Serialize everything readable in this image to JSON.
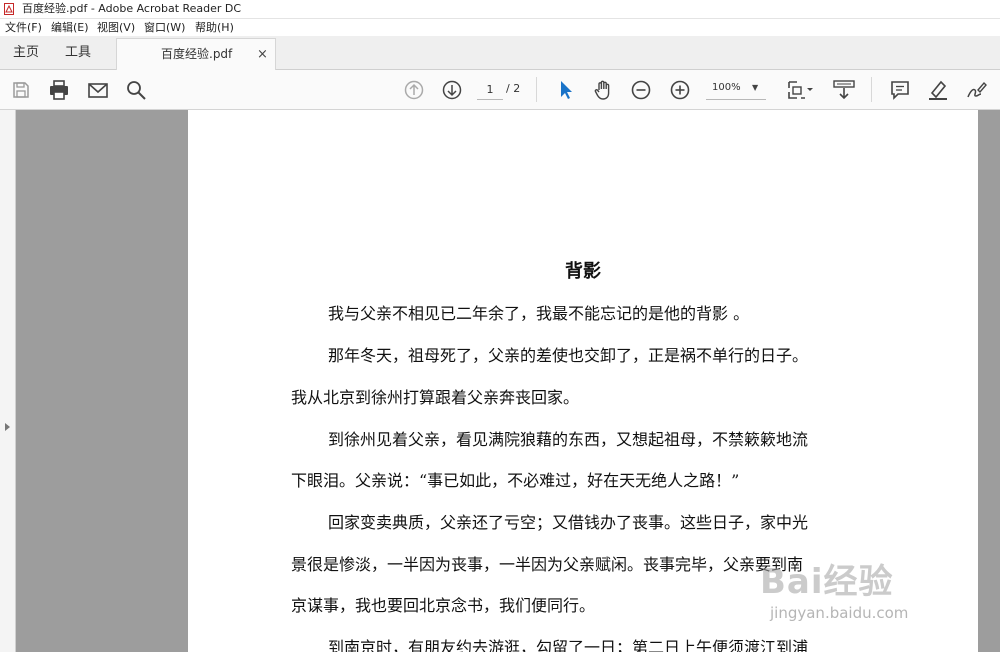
{
  "window": {
    "title": "百度经验.pdf - Adobe Acrobat Reader DC"
  },
  "menu": [
    "文件(F)",
    "编辑(E)",
    "视图(V)",
    "窗口(W)",
    "帮助(H)"
  ],
  "tabs": {
    "home": "主页",
    "tools": "工具",
    "document": "百度经验.pdf",
    "close": "×"
  },
  "toolbar": {
    "icons": [
      "save-icon",
      "print-icon",
      "email-icon",
      "search-icon",
      "page-up-icon",
      "page-down-icon",
      "select-cursor-icon",
      "hand-tool-icon",
      "zoom-out-icon",
      "zoom-in-icon",
      "fit-page-icon",
      "scroll-mode-icon",
      "comment-icon",
      "highlight-icon",
      "sign-icon"
    ],
    "page_current": "1",
    "page_total": "/ 2",
    "zoom": "100%",
    "accent": "#1a73c8"
  },
  "document": {
    "title": "背影",
    "lines": [
      "我与父亲不相见已二年余了，我最不能忘记的是他的背影 。",
      "那年冬天，祖母死了，父亲的差使也交卸了，正是祸不单行的日子。",
      "我从北京到徐州打算跟着父亲奔丧回家。",
      "到徐州见着父亲，看见满院狼藉的东西，又想起祖母，不禁簌簌地流",
      "下眼泪。父亲说：“事已如此，不必难过，好在天无绝人之路！”",
      "回家变卖典质，父亲还了亏空；又借钱办了丧事。这些日子，家中光",
      "景很是惨淡，一半因为丧事，一半因为父亲赋闲。丧事完毕，父亲要到南",
      "京谋事，我也要回北京念书，我们便同行。",
      "到南京时，有朋友约去游逛，勾留了一日；第二日上午便须渡江到浦"
    ]
  },
  "watermark": {
    "brand": "Bai经验",
    "url": "jingyan.baidu.com"
  }
}
